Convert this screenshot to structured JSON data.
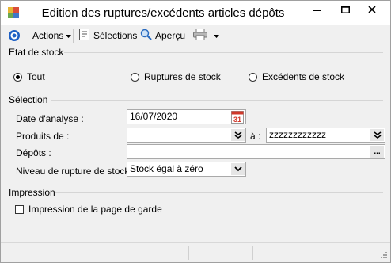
{
  "window": {
    "title": "Edition des ruptures/excédents articles dépôts"
  },
  "toolbar": {
    "actions_label": "Actions",
    "selections_label": "Sélections",
    "apercu_label": "Aperçu"
  },
  "etat": {
    "label": "Etat de stock",
    "options": [
      "Tout",
      "Ruptures de stock",
      "Excédents de stock"
    ],
    "selected": "Tout"
  },
  "selection": {
    "label": "Sélection",
    "date_label": "Date d'analyse :",
    "date_value": "16/07/2020",
    "calendar_day": "31",
    "produits_label": "Produits de :",
    "produits_from": "",
    "a_label": "à :",
    "produits_to": "zzzzzzzzzzzz",
    "depots_label": "Dépôts :",
    "depots_value": "",
    "more_label": "...",
    "niveau_label": "Niveau de rupture de stock :",
    "niveau_value": "Stock égal à zéro"
  },
  "impression": {
    "label": "Impression",
    "page_garde_label": "Impression de la page de garde",
    "page_garde_checked": false
  },
  "icons": {
    "app": "app-icon",
    "target": "target-icon",
    "dropdown": "chevron-down-icon",
    "selections": "document-icon",
    "apercu": "magnifier-icon",
    "print": "printer-icon",
    "calendar": "calendar-icon",
    "double_chevron": "double-chevron-down-icon"
  },
  "colors": {
    "accent": "#1d5fc4",
    "calendar_red": "#d0392b"
  }
}
